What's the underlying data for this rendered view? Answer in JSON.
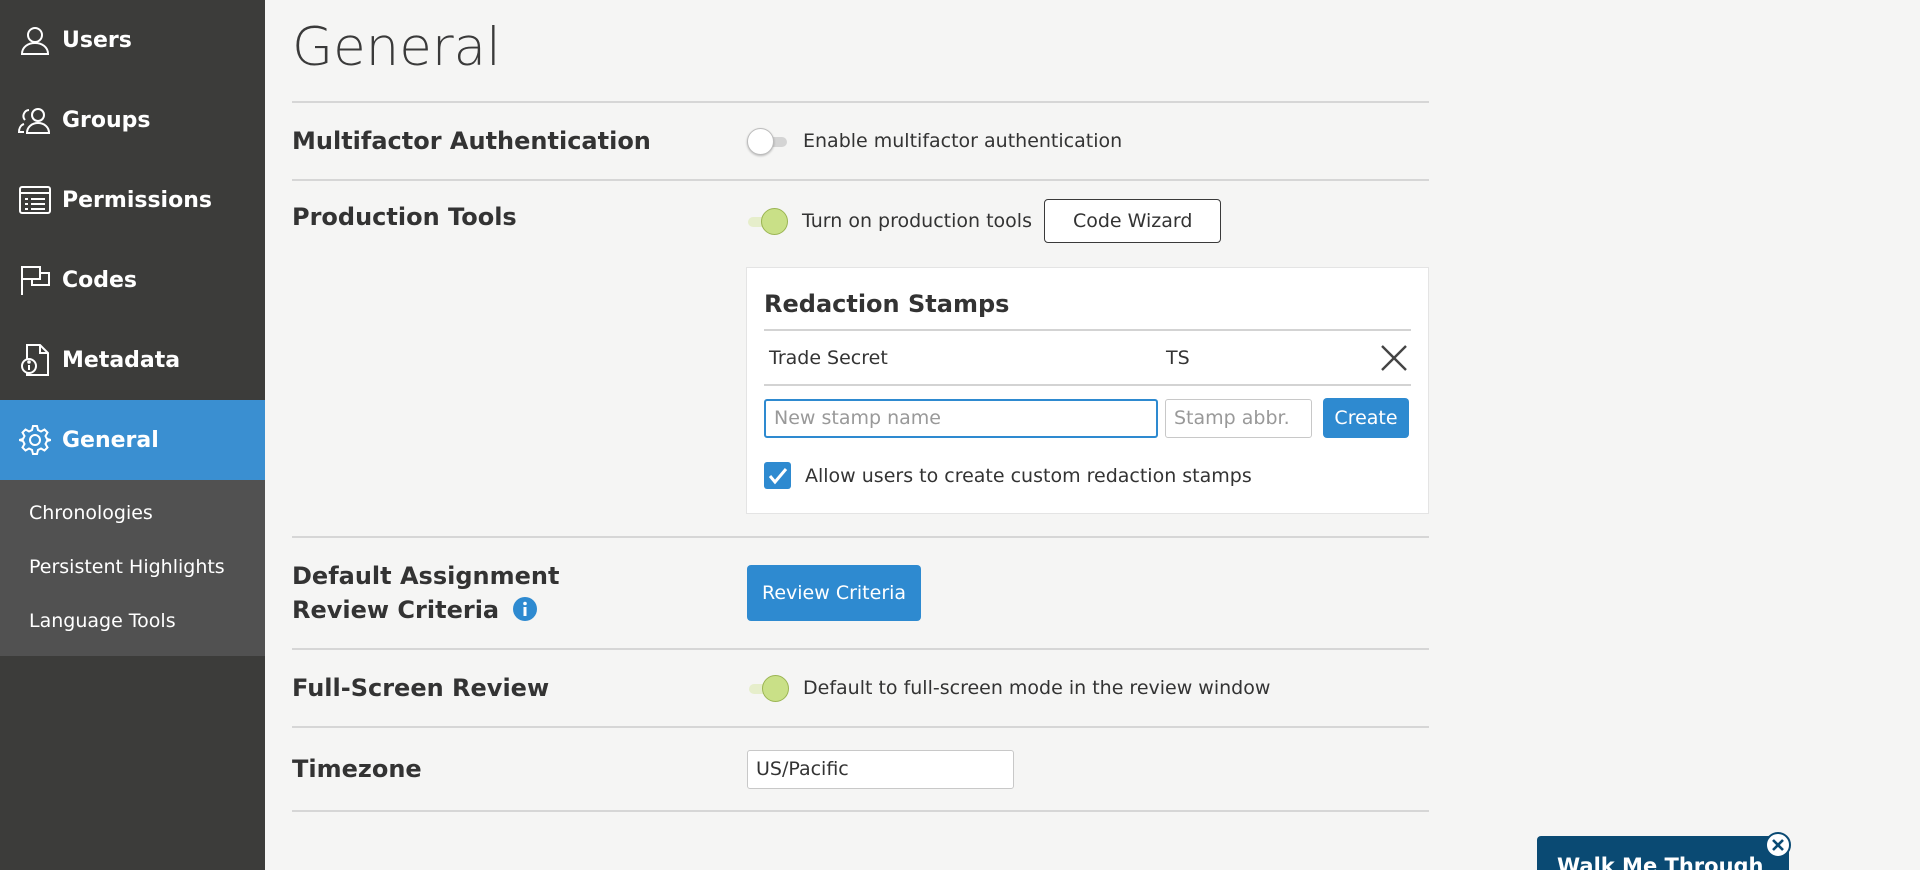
{
  "sidebar": {
    "items": [
      {
        "label": "Users",
        "icon": "user-icon"
      },
      {
        "label": "Groups",
        "icon": "users-icon"
      },
      {
        "label": "Permissions",
        "icon": "list-icon"
      },
      {
        "label": "Codes",
        "icon": "flag-icon"
      },
      {
        "label": "Metadata",
        "icon": "file-info-icon"
      },
      {
        "label": "General",
        "icon": "gear-icon",
        "active": true
      }
    ],
    "subitems": [
      {
        "label": "Chronologies"
      },
      {
        "label": "Persistent Highlights"
      },
      {
        "label": "Language Tools"
      }
    ]
  },
  "page": {
    "title": "General"
  },
  "mfa": {
    "label": "Multifactor Authentication",
    "toggle_label": "Enable multifactor authentication",
    "enabled": false
  },
  "production": {
    "label": "Production Tools",
    "toggle_label": "Turn on production tools",
    "enabled": true,
    "code_wizard_label": "Code Wizard"
  },
  "stamps": {
    "title": "Redaction Stamps",
    "rows": [
      {
        "name": "Trade Secret",
        "abbr": "TS"
      }
    ],
    "name_placeholder": "New stamp name",
    "abbr_placeholder": "Stamp abbr.",
    "create_label": "Create",
    "allow_custom_label": "Allow users to create custom redaction stamps",
    "allow_custom_checked": true
  },
  "review_criteria": {
    "label_line1": "Default Assignment",
    "label_line2": "Review Criteria",
    "button_label": "Review Criteria"
  },
  "fullscreen": {
    "label": "Full-Screen Review",
    "toggle_label": "Default to full-screen mode in the review window",
    "enabled": true
  },
  "timezone": {
    "label": "Timezone",
    "value": "US/Pacific"
  },
  "walkme": {
    "label": "Walk Me Through"
  },
  "colors": {
    "sidebar": "#3c3c3a",
    "accent": "#3a8fd1",
    "toggle_on": "#c9e087",
    "walkme": "#0a4a73"
  }
}
